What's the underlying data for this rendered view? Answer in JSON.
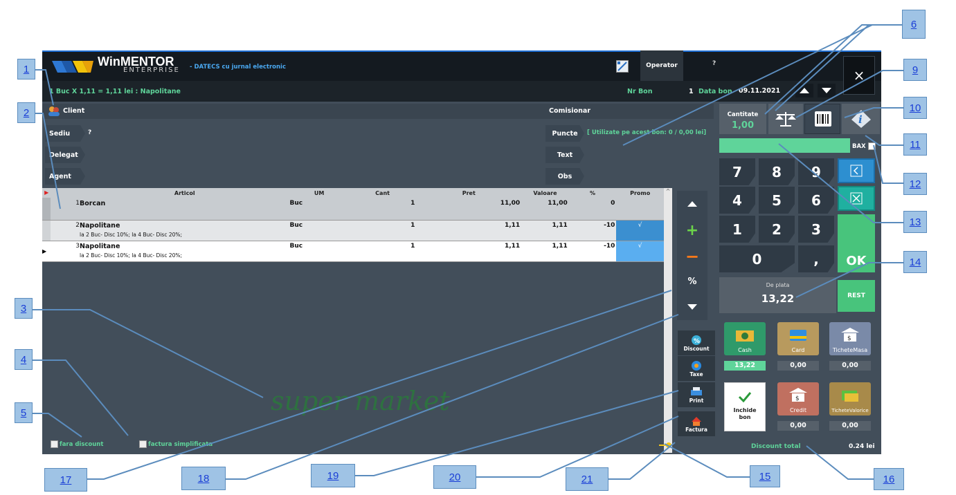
{
  "callouts": [
    "1",
    "2",
    "3",
    "4",
    "5",
    "6",
    "9",
    "10",
    "11",
    "12",
    "13",
    "14",
    "15",
    "16",
    "17",
    "18",
    "19",
    "20",
    "21"
  ],
  "app": {
    "logo_win": "Win",
    "logo_mentor": "MENTOR",
    "logo_enterprise": "ENTERPRISE",
    "subtitle": "- DATECS cu jurnal electronic",
    "operator": "Operator",
    "help": "?",
    "close": "×"
  },
  "status": {
    "last_item": "1 Buc X 1,11  = 1,11 lei : Napolitane",
    "nr_bon_label": "Nr Bon",
    "nr_bon": "1",
    "data_bon_label": "Data bon",
    "data_bon": "09.11.2021"
  },
  "client": {
    "label": "Client",
    "sediu": "Sediu",
    "sediu_value": "?",
    "delegat": "Delegat",
    "agent": "Agent",
    "comisionar": "Comisionar",
    "puncte": "Puncte",
    "puncte_info": "[ Utilizate pe acest bon: 0 / 0,00 lei]",
    "text": "Text",
    "obs": "Obs"
  },
  "table": {
    "headers": [
      "Articol",
      "UM",
      "Cant",
      "Pret",
      "Valoare",
      "%",
      "Promo"
    ],
    "rows": [
      {
        "nr": "1",
        "articol": "Borcan",
        "desc": "",
        "um": "Buc",
        "cant": "1",
        "pret": "11,00",
        "valoare": "11,00",
        "pct": "0",
        "promo": ""
      },
      {
        "nr": "2",
        "articol": "Napolitane",
        "desc": "la 2 Buc- Disc 10%; la 4 Buc- Disc 20%;",
        "um": "Buc",
        "cant": "1",
        "pret": "1,11",
        "valoare": "1,11",
        "pct": "-10",
        "promo": "√"
      },
      {
        "nr": "3",
        "articol": "Napolitane",
        "desc": "la 2 Buc- Disc 10%; la 4 Buc- Disc 20%;",
        "um": "Buc",
        "cant": "1",
        "pret": "1,11",
        "valoare": "1,11",
        "pct": "-10",
        "promo": "√"
      }
    ]
  },
  "watermark": "super market",
  "checkbox_fara": "fara discount",
  "checkbox_factura": "factura simplificata",
  "side": {
    "plus": "+",
    "minus": "−",
    "pct": "%"
  },
  "actions": {
    "discount": "Discount",
    "taxe": "Taxe",
    "print": "Print",
    "factura": "Factura"
  },
  "qty": {
    "label": "Cantitate",
    "value": "1,00",
    "bax": "BAX"
  },
  "keypad": {
    "k7": "7",
    "k8": "8",
    "k9": "9",
    "k4": "4",
    "k5": "5",
    "k6": "6",
    "k1": "1",
    "k2": "2",
    "k3": "3",
    "k0": "0",
    "comma": ",",
    "ok": "OK"
  },
  "total": {
    "label": "De plata",
    "value": "13,22",
    "rest": "REST"
  },
  "payments": {
    "cash": "Cash",
    "cash_value": "13,22",
    "card": "Card",
    "card_value": "0,00",
    "tichete_masa": "TicheteMasa",
    "tichete_masa_value": "0,00",
    "inchide": "Inchide bon",
    "credit": "Credit",
    "credit_value": "0,00",
    "tichete_valorice": "TicheteValorice",
    "tichete_valorice_value": "0,00"
  },
  "discount": {
    "label": "Discount total",
    "value": "0.24 lei"
  },
  "colors": {
    "bg": "#424e5a",
    "top": "#141a20",
    "accent": "#5fd49a",
    "ok": "#48c47c",
    "promo": "#4aa0de"
  }
}
